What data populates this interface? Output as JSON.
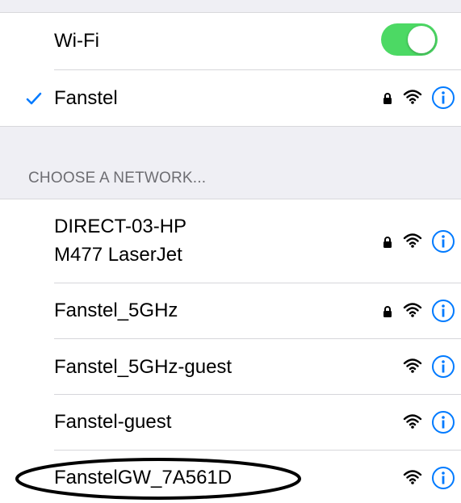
{
  "wifi": {
    "label": "Wi-Fi",
    "enabled": true,
    "toggle_color": "#4cd964"
  },
  "connected": {
    "name": "Fanstel",
    "checkmark_icon": "checkmark-icon",
    "secured": true
  },
  "section": {
    "header": "CHOOSE A NETWORK..."
  },
  "networks": [
    {
      "name_line1": "DIRECT-03-HP",
      "name_line2": "M477 LaserJet",
      "secured": true
    },
    {
      "name": "Fanstel_5GHz",
      "secured": true
    },
    {
      "name": "Fanstel_5GHz-guest",
      "secured": false
    },
    {
      "name": "Fanstel-guest",
      "secured": false
    },
    {
      "name": "FanstelGW_7A561D",
      "secured": false,
      "circled": true
    }
  ],
  "icons": {
    "lock": "lock-icon",
    "wifi": "wifi-icon",
    "info": "info-icon"
  },
  "colors": {
    "accent": "#007aff",
    "section_bg": "#efeff4",
    "section_text": "#6d6d72"
  }
}
